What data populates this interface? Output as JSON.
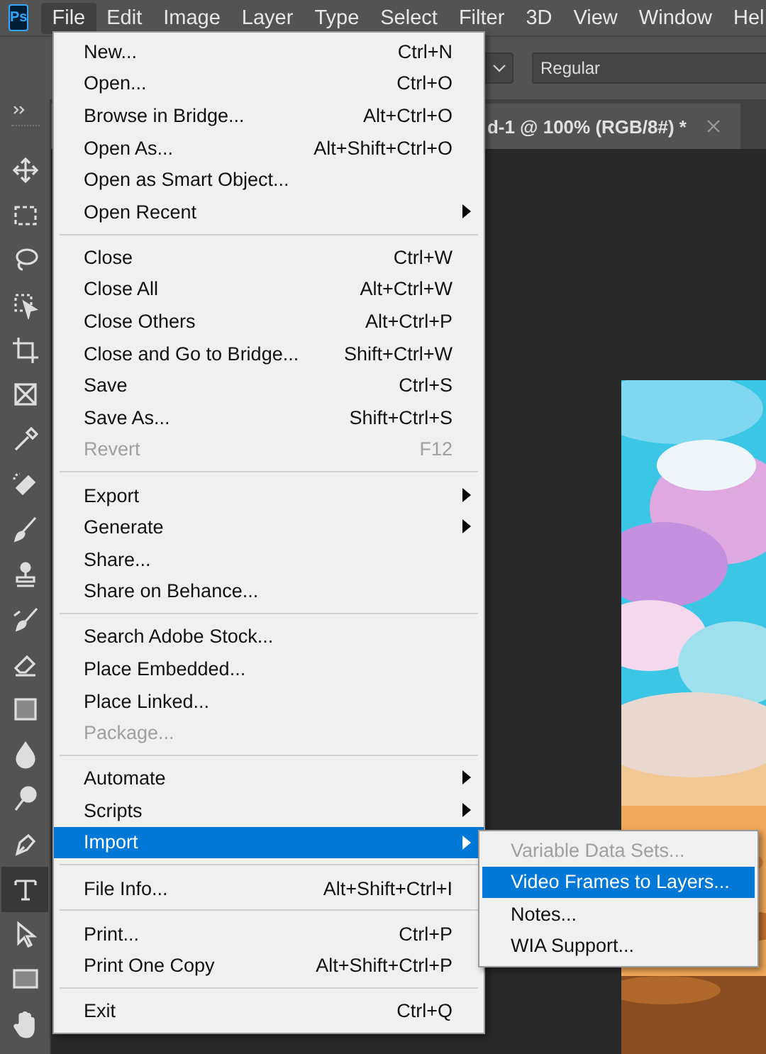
{
  "app": {
    "logo": "Ps"
  },
  "menu_bar": [
    {
      "label": "File",
      "selected": true
    },
    {
      "label": "Edit",
      "selected": false
    },
    {
      "label": "Image",
      "selected": false
    },
    {
      "label": "Layer",
      "selected": false
    },
    {
      "label": "Type",
      "selected": false
    },
    {
      "label": "Select",
      "selected": false
    },
    {
      "label": "Filter",
      "selected": false
    },
    {
      "label": "3D",
      "selected": false
    },
    {
      "label": "View",
      "selected": false
    },
    {
      "label": "Window",
      "selected": false
    },
    {
      "label": "Hel",
      "selected": false
    }
  ],
  "options_bar": {
    "font_style": "Regular"
  },
  "document_tab": {
    "title": "d-1 @ 100% (RGB/8#) *"
  },
  "tools": [
    {
      "selected": false
    },
    {
      "selected": false
    },
    {
      "selected": false
    },
    {
      "selected": false
    },
    {
      "selected": false
    },
    {
      "selected": false
    },
    {
      "selected": false
    },
    {
      "selected": false
    },
    {
      "selected": false
    },
    {
      "selected": false
    },
    {
      "selected": false
    },
    {
      "selected": false
    },
    {
      "selected": false
    },
    {
      "selected": false
    },
    {
      "selected": false
    },
    {
      "selected": false
    },
    {
      "selected": true
    },
    {
      "selected": false
    },
    {
      "selected": false
    },
    {
      "selected": false
    }
  ],
  "file_menu": {
    "groups": [
      {
        "items": [
          {
            "label": "New...",
            "shortcut": "Ctrl+N",
            "has_submenu": false,
            "disabled": false,
            "selected": false
          },
          {
            "label": "Open...",
            "shortcut": "Ctrl+O",
            "has_submenu": false,
            "disabled": false,
            "selected": false
          },
          {
            "label": "Browse in Bridge...",
            "shortcut": "Alt+Ctrl+O",
            "has_submenu": false,
            "disabled": false,
            "selected": false
          },
          {
            "label": "Open As...",
            "shortcut": "Alt+Shift+Ctrl+O",
            "has_submenu": false,
            "disabled": false,
            "selected": false
          },
          {
            "label": "Open as Smart Object...",
            "has_submenu": false,
            "disabled": false,
            "selected": false
          },
          {
            "label": "Open Recent",
            "has_submenu": true,
            "disabled": false,
            "selected": false
          }
        ]
      },
      {
        "items": [
          {
            "label": "Close",
            "shortcut": "Ctrl+W",
            "has_submenu": false,
            "disabled": false,
            "selected": false
          },
          {
            "label": "Close All",
            "shortcut": "Alt+Ctrl+W",
            "has_submenu": false,
            "disabled": false,
            "selected": false
          },
          {
            "label": "Close Others",
            "shortcut": "Alt+Ctrl+P",
            "has_submenu": false,
            "disabled": false,
            "selected": false
          },
          {
            "label": "Close and Go to Bridge...",
            "shortcut": "Shift+Ctrl+W",
            "has_submenu": false,
            "disabled": false,
            "selected": false
          },
          {
            "label": "Save",
            "shortcut": "Ctrl+S",
            "has_submenu": false,
            "disabled": false,
            "selected": false
          },
          {
            "label": "Save As...",
            "shortcut": "Shift+Ctrl+S",
            "has_submenu": false,
            "disabled": false,
            "selected": false
          },
          {
            "label": "Revert",
            "shortcut": "F12",
            "has_submenu": false,
            "disabled": true,
            "selected": false
          }
        ]
      },
      {
        "items": [
          {
            "label": "Export",
            "has_submenu": true,
            "disabled": false,
            "selected": false
          },
          {
            "label": "Generate",
            "has_submenu": true,
            "disabled": false,
            "selected": false
          },
          {
            "label": "Share...",
            "has_submenu": false,
            "disabled": false,
            "selected": false
          },
          {
            "label": "Share on Behance...",
            "has_submenu": false,
            "disabled": false,
            "selected": false
          }
        ]
      },
      {
        "items": [
          {
            "label": "Search Adobe Stock...",
            "has_submenu": false,
            "disabled": false,
            "selected": false
          },
          {
            "label": "Place Embedded...",
            "has_submenu": false,
            "disabled": false,
            "selected": false
          },
          {
            "label": "Place Linked...",
            "has_submenu": false,
            "disabled": false,
            "selected": false
          },
          {
            "label": "Package...",
            "has_submenu": false,
            "disabled": true,
            "selected": false
          }
        ]
      },
      {
        "items": [
          {
            "label": "Automate",
            "has_submenu": true,
            "disabled": false,
            "selected": false
          },
          {
            "label": "Scripts",
            "has_submenu": true,
            "disabled": false,
            "selected": false
          },
          {
            "label": "Import",
            "has_submenu": true,
            "disabled": false,
            "selected": true
          }
        ]
      },
      {
        "items": [
          {
            "label": "File Info...",
            "shortcut": "Alt+Shift+Ctrl+I",
            "has_submenu": false,
            "disabled": false,
            "selected": false
          }
        ]
      },
      {
        "items": [
          {
            "label": "Print...",
            "shortcut": "Ctrl+P",
            "has_submenu": false,
            "disabled": false,
            "selected": false
          },
          {
            "label": "Print One Copy",
            "shortcut": "Alt+Shift+Ctrl+P",
            "has_submenu": false,
            "disabled": false,
            "selected": false
          }
        ]
      },
      {
        "items": [
          {
            "label": "Exit",
            "shortcut": "Ctrl+Q",
            "has_submenu": false,
            "disabled": false,
            "selected": false
          }
        ]
      }
    ]
  },
  "import_submenu": {
    "items": [
      {
        "label": "Variable Data Sets...",
        "disabled": true,
        "selected": false
      },
      {
        "label": "Video Frames to Layers...",
        "disabled": false,
        "selected": true
      },
      {
        "label": "Notes...",
        "disabled": false,
        "selected": false
      },
      {
        "label": "WIA Support...",
        "disabled": false,
        "selected": false
      }
    ]
  }
}
